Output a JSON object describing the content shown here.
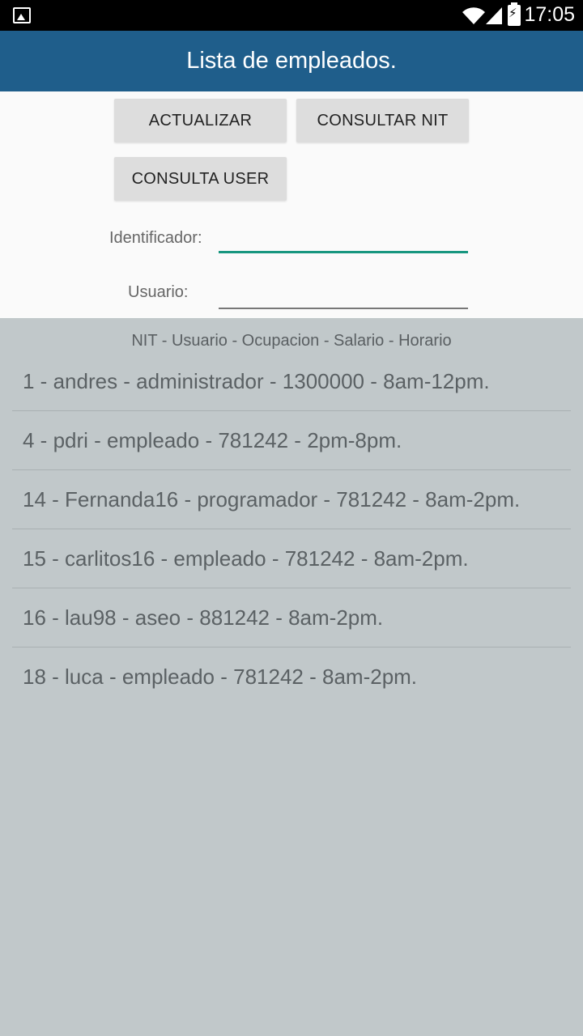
{
  "status_bar": {
    "time": "17:05",
    "icons": [
      "image-icon",
      "wifi-icon",
      "signal-icon",
      "battery-charging-icon"
    ]
  },
  "app_bar": {
    "title": "Lista de empleados."
  },
  "buttons": {
    "actualizar": "ACTUALIZAR",
    "consultar_nit": "CONSULTAR NIT",
    "consulta_user": "CONSULTA USER"
  },
  "form": {
    "identificador_label": "Identificador:",
    "identificador_value": "",
    "usuario_label": "Usuario:",
    "usuario_value": ""
  },
  "list": {
    "header": "NIT - Usuario - Ocupacion  - Salario - Horario",
    "items": [
      "1 - andres - administrador - 1300000 - 8am-12pm.",
      "4 - pdri - empleado - 781242 - 2pm-8pm.",
      "14 - Fernanda16 - programador - 781242 - 8am-2pm.",
      "15 - carlitos16 - empleado - 781242 - 8am-2pm.",
      "16 - lau98 - aseo - 881242 - 8am-2pm.",
      "18 - luca - empleado - 781242 - 8am-2pm."
    ]
  },
  "colors": {
    "app_bar": "#1f5e8b",
    "list_background": "#c1c8ca",
    "input_focus": "#17967f"
  }
}
